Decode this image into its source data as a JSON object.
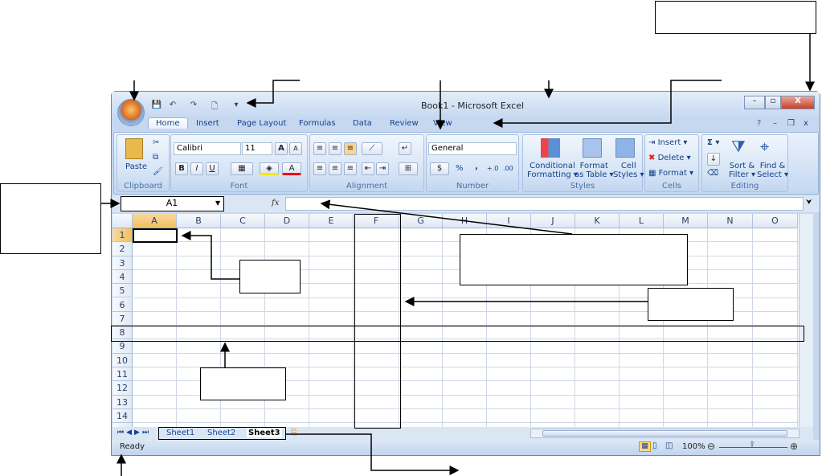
{
  "window": {
    "title": "Book1 - Microsoft Excel"
  },
  "qat": {
    "save": "💾",
    "undo": "↶",
    "redo": "↷",
    "new": "🗋",
    "customize": "▾"
  },
  "window_controls": {
    "minimize": "–",
    "maximize": "▫",
    "close": "X"
  },
  "workbook_controls": {
    "help": "?",
    "minimize": "–",
    "restore": "❐",
    "close": "x"
  },
  "tabs": [
    "Home",
    "Insert",
    "Page Layout",
    "Formulas",
    "Data",
    "Review",
    "View"
  ],
  "ribbon": {
    "clipboard": {
      "label": "Clipboard",
      "paste": "Paste"
    },
    "font": {
      "label": "Font",
      "font_name": "Calibri",
      "font_size": "11",
      "bold": "B",
      "italic": "I",
      "underline": "U",
      "grow": "A",
      "shrink": "A",
      "font_color": "A"
    },
    "alignment": {
      "label": "Alignment"
    },
    "number": {
      "label": "Number",
      "format": "General",
      "percent": "%",
      "comma": ",",
      "inc_dec": "+.0",
      "dec_dec": ".00"
    },
    "styles": {
      "label": "Styles",
      "conditional": [
        "Conditional",
        "Formatting ▾"
      ],
      "format_table": [
        "Format",
        "as Table ▾"
      ],
      "cell_styles": [
        "Cell",
        "Styles ▾"
      ]
    },
    "cells": {
      "label": "Cells",
      "insert": "Insert ▾",
      "delete": "Delete ▾",
      "format": "Format ▾"
    },
    "editing": {
      "label": "Editing",
      "sum": "Σ ▾",
      "sort": [
        "Sort &",
        "Filter ▾"
      ],
      "find": [
        "Find &",
        "Select ▾"
      ]
    }
  },
  "formula_bar": {
    "name_box": "A1",
    "fx": "fx",
    "value": ""
  },
  "columns": [
    "A",
    "B",
    "C",
    "D",
    "E",
    "F",
    "G",
    "H",
    "I",
    "J",
    "K",
    "L",
    "M",
    "N",
    "O"
  ],
  "rows": [
    "1",
    "2",
    "3",
    "4",
    "5",
    "6",
    "7",
    "8",
    "9",
    "10",
    "11",
    "12",
    "13",
    "14"
  ],
  "sheets": [
    "Sheet1",
    "Sheet2",
    "Sheet3"
  ],
  "active_sheet": "Sheet3",
  "status": {
    "text": "Ready",
    "zoom": "100%"
  },
  "colors": {
    "ribbon": "#c4d8f1",
    "accent": "#15428b",
    "annotation": "#000000"
  }
}
